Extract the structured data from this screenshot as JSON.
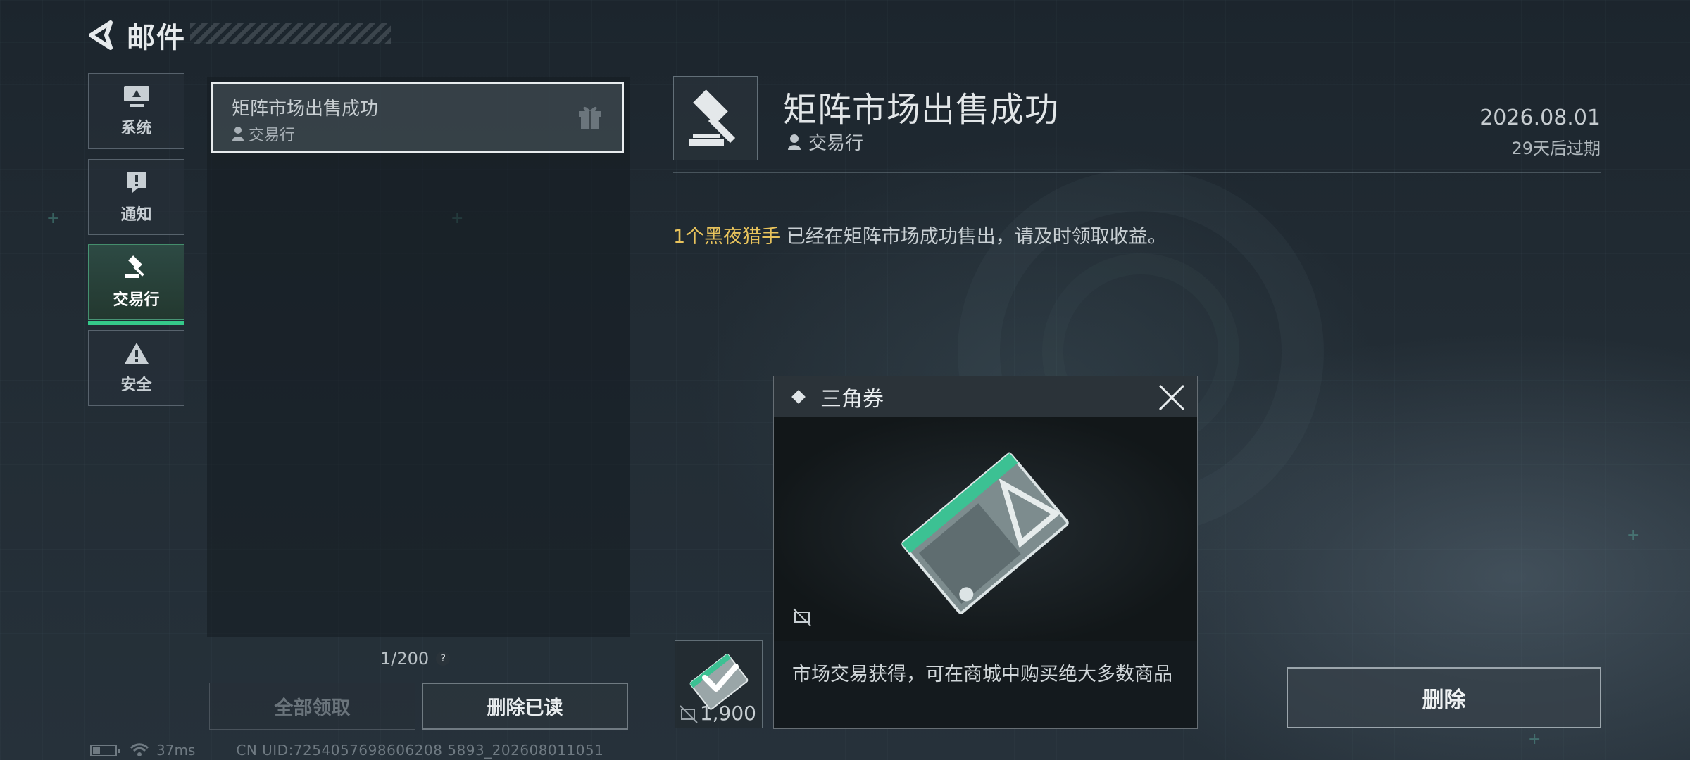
{
  "header": {
    "title": "邮件"
  },
  "tabs": [
    {
      "id": "system",
      "label": "系统",
      "icon": "monitor-icon",
      "active": false
    },
    {
      "id": "notice",
      "label": "通知",
      "icon": "exclamation-icon",
      "active": false
    },
    {
      "id": "trade",
      "label": "交易行",
      "icon": "gavel-icon",
      "active": true
    },
    {
      "id": "security",
      "label": "安全",
      "icon": "warning-icon",
      "active": false
    }
  ],
  "mail_list": {
    "items": [
      {
        "title": "矩阵市场出售成功",
        "sender": "交易行",
        "icon": "gift-icon"
      }
    ],
    "page_count": "1/200",
    "claim_all_label": "全部领取",
    "delete_read_label": "删除已读"
  },
  "detail": {
    "title": "矩阵市场出售成功",
    "sender": "交易行",
    "date": "2026.08.01",
    "expire": "29天后过期",
    "body_highlight": "1个黑夜猎手",
    "body_text": " 已经在矩阵市场成功售出，请及时领取收益。",
    "attachment_qty": "1,900",
    "delete_label": "删除"
  },
  "popup": {
    "title": "三角券",
    "description": "市场交易获得，可在商城中购买绝大多数商品"
  },
  "status": {
    "ping": "37ms",
    "uid": "CN UID:7254057698606208 5893_202608011051"
  },
  "colors": {
    "accent_green": "#35c98a",
    "highlight_gold": "#e8c35c"
  }
}
